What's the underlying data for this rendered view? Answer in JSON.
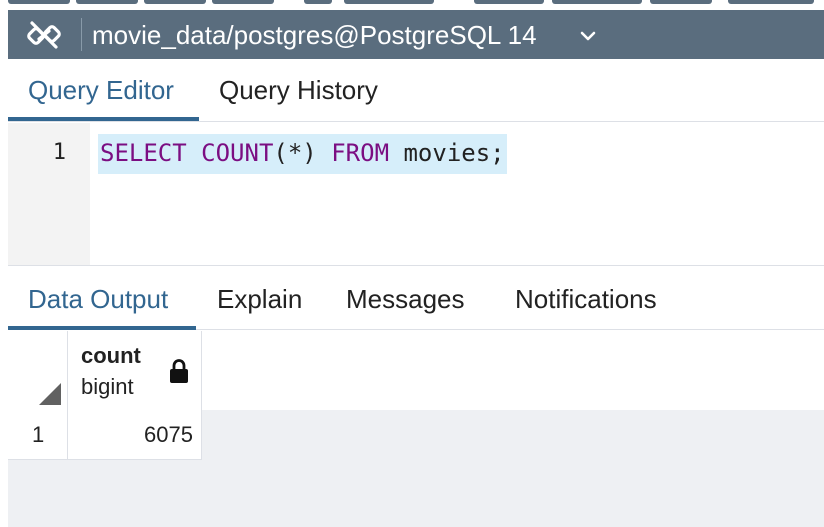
{
  "connection": {
    "label": "movie_data/postgres@PostgreSQL 14",
    "icon": "link-off-icon",
    "caret_icon": "chevron-down-icon"
  },
  "editor_tabs": [
    {
      "label": "Query Editor",
      "active": true
    },
    {
      "label": "Query History",
      "active": false
    }
  ],
  "editor": {
    "line_number": "1",
    "tokens": {
      "select": "SELECT",
      "count": "COUNT",
      "paren": "(*)",
      "from": "FROM",
      "table": "movies;"
    }
  },
  "output_tabs": [
    {
      "label": "Data Output",
      "active": true
    },
    {
      "label": "Explain",
      "active": false
    },
    {
      "label": "Messages",
      "active": false
    },
    {
      "label": "Notifications",
      "active": false
    }
  ],
  "grid": {
    "columns": [
      {
        "name": "count",
        "type": "bigint",
        "icon": "lock-icon"
      }
    ],
    "rows": [
      {
        "row_number": "1",
        "values": [
          "6075"
        ]
      }
    ]
  },
  "colors": {
    "header_bg": "#5a6d7e",
    "active_tab": "#326690",
    "keyword": "#7b0e82",
    "line_highlight": "#d6eefa"
  }
}
